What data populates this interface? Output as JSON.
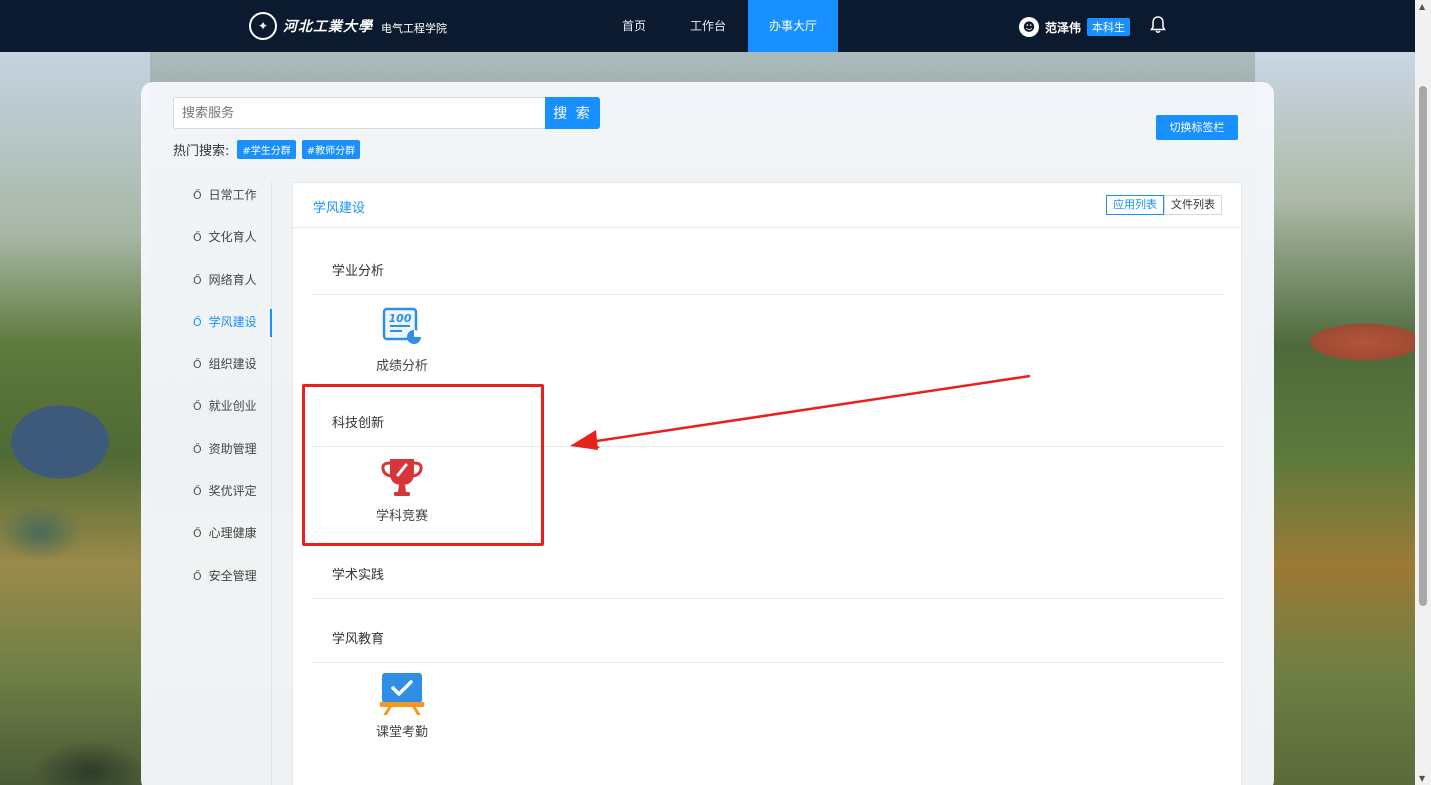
{
  "header": {
    "university": "河北工業大學",
    "college": "电气工程学院",
    "nav": [
      {
        "label": "首页"
      },
      {
        "label": "工作台"
      },
      {
        "label": "办事大厅"
      }
    ],
    "active_nav": "办事大厅",
    "user": {
      "name": "范泽伟",
      "badge": "本科生"
    },
    "icons": {
      "avatar": "user-avatar-icon",
      "notification": "bell-icon"
    }
  },
  "search": {
    "placeholder": "搜索服务",
    "button_label": "搜 索",
    "hot_label": "热门搜索:",
    "hot_tags": [
      "#学生分群",
      "#教师分群"
    ]
  },
  "switch_button_label": "切换标签栏",
  "sidebar": {
    "items": [
      {
        "label": "日常工作"
      },
      {
        "label": "文化育人"
      },
      {
        "label": "网络育人"
      },
      {
        "label": "学风建设"
      },
      {
        "label": "组织建设"
      },
      {
        "label": "就业创业"
      },
      {
        "label": "资助管理"
      },
      {
        "label": "奖优评定"
      },
      {
        "label": "心理健康"
      },
      {
        "label": "安全管理"
      }
    ],
    "active": "学风建设"
  },
  "content": {
    "title": "学风建设",
    "view_toggle": [
      "应用列表",
      "文件列表"
    ],
    "active_view": "应用列表",
    "sections": [
      {
        "title": "学业分析",
        "apps": [
          {
            "label": "成绩分析",
            "icon": "score-analysis-icon"
          }
        ]
      },
      {
        "title": "科技创新",
        "apps": [
          {
            "label": "学科竞赛",
            "icon": "trophy-icon"
          }
        ]
      },
      {
        "title": "学术实践",
        "apps": []
      },
      {
        "title": "学风教育",
        "apps": [
          {
            "label": "课堂考勤",
            "icon": "attendance-icon"
          }
        ]
      }
    ]
  },
  "annotation": {
    "highlight_color": "#e8221b"
  },
  "colors": {
    "accent": "#1890ff",
    "topbar": "#0b1a2f"
  }
}
